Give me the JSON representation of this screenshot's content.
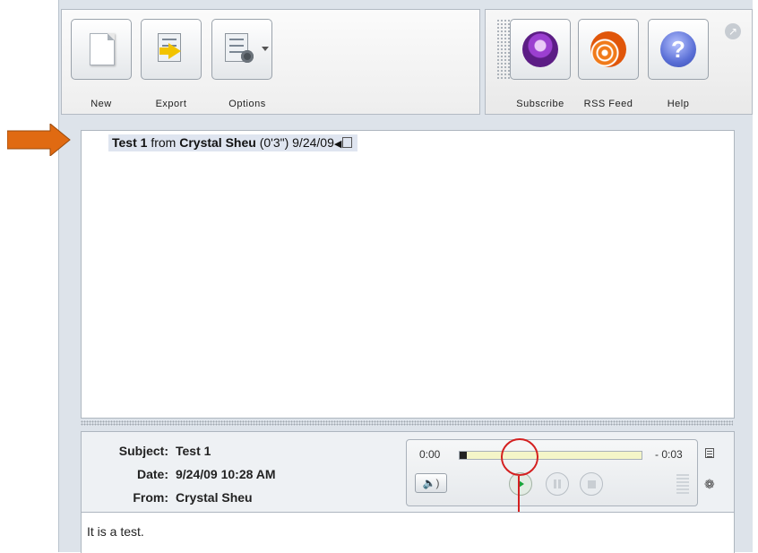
{
  "toolbar": {
    "new_label": "New",
    "export_label": "Export",
    "options_label": "Options",
    "subscribe_label": "Subscribe",
    "rss_label": "RSS Feed",
    "help_label": "Help"
  },
  "list": {
    "message": {
      "subject": "Test 1",
      "from_word": "from",
      "sender": "Crystal Sheu",
      "duration": "(0'3\")",
      "date": "9/24/09"
    }
  },
  "details": {
    "subject_label": "Subject:",
    "subject_value": "Test 1",
    "date_label": "Date:",
    "date_value": "9/24/09 10:28 AM",
    "from_label": "From:",
    "from_value": "Crystal Sheu"
  },
  "player": {
    "elapsed": "0:00",
    "remaining": "- 0:03",
    "progress": 0.04
  },
  "body": {
    "text": "It is a test."
  },
  "colors": {
    "accent_orange": "#e06a12",
    "annotation_red": "#d42020",
    "podcast_purple": "#9b3fd0",
    "help_blue": "#5a6fd6"
  }
}
